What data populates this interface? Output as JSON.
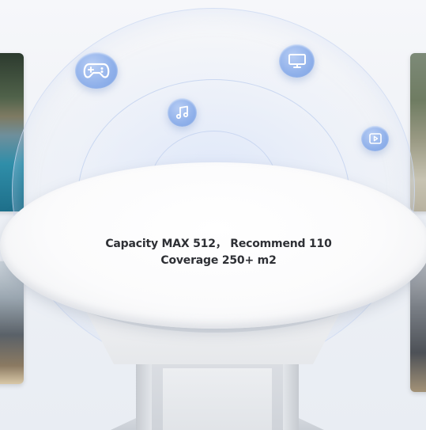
{
  "specs": {
    "line1": "Capacity MAX 512， Recommend 110",
    "line2": "Coverage 250+ m2"
  },
  "icons": {
    "top_left": "gamepad-icon",
    "top_right": "monitor-icon",
    "center": "music-note-icon",
    "right": "video-play-icon"
  },
  "colors": {
    "icon_bubble": "#8fb0ea",
    "coverage_arc": "#c8d6f0",
    "text": "#2e3035"
  }
}
